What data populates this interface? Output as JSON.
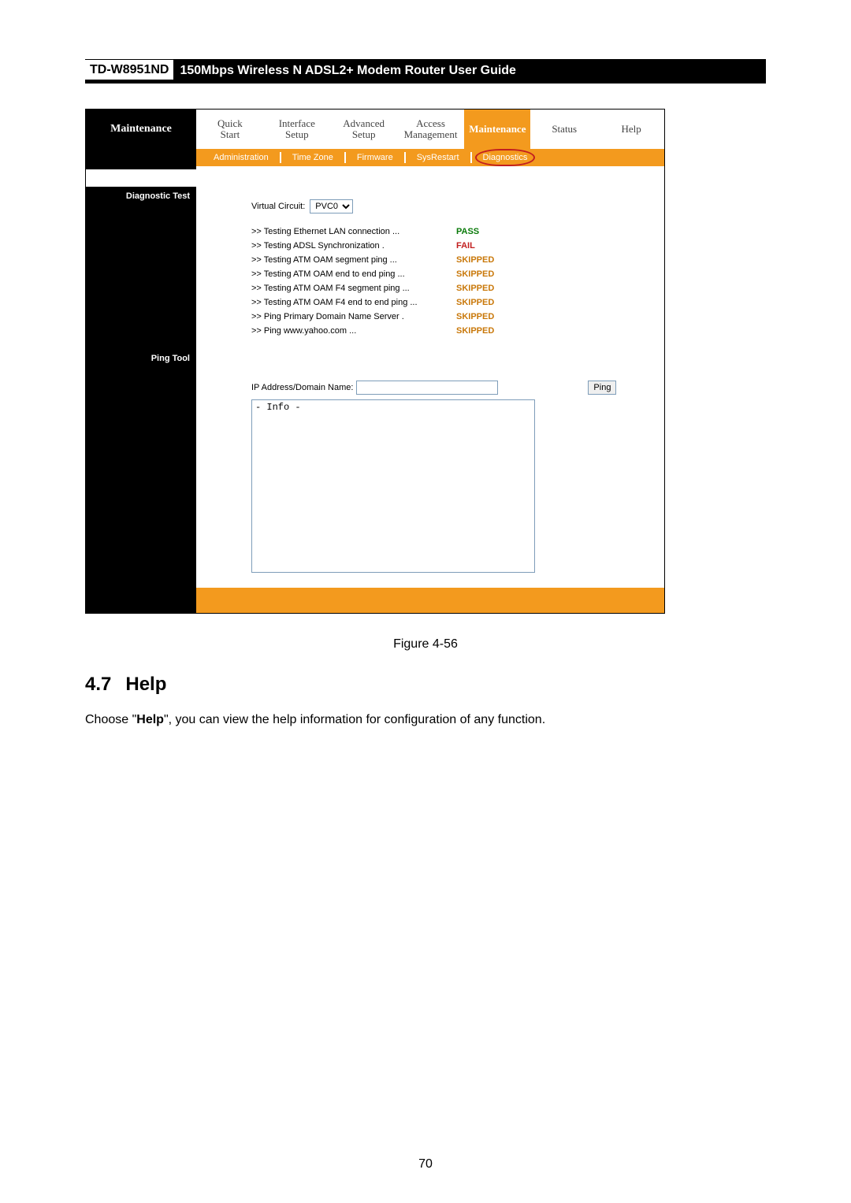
{
  "doc_header": {
    "model": "TD-W8951ND",
    "title": "150Mbps Wireless N ADSL2+ Modem Router User Guide"
  },
  "toptabs": {
    "side_label": "Maintenance",
    "items": [
      {
        "line1": "Quick",
        "line2": "Start"
      },
      {
        "line1": "Interface",
        "line2": "Setup"
      },
      {
        "line1": "Advanced",
        "line2": "Setup"
      },
      {
        "line1": "Access",
        "line2": "Management"
      },
      {
        "line1": "Maintenance",
        "line2": ""
      },
      {
        "line1": "Status",
        "line2": ""
      },
      {
        "line1": "Help",
        "line2": ""
      }
    ]
  },
  "subtabs": {
    "items": [
      "Administration",
      "Time Zone",
      "Firmware",
      "SysRestart",
      "Diagnostics"
    ]
  },
  "sections": {
    "diag_label": "Diagnostic Test",
    "ping_label": "Ping Tool"
  },
  "vc": {
    "label": "Virtual Circuit:",
    "value": "PVC0"
  },
  "diag_tests": [
    {
      "desc": ">> Testing Ethernet LAN connection ...",
      "result": "PASS",
      "cls": "pass"
    },
    {
      "desc": ">> Testing ADSL Synchronization .",
      "result": "FAIL",
      "cls": "fail"
    },
    {
      "desc": ">> Testing ATM OAM segment ping ...",
      "result": "SKIPPED",
      "cls": "skipped"
    },
    {
      "desc": ">> Testing ATM OAM end to end ping ...",
      "result": "SKIPPED",
      "cls": "skipped"
    },
    {
      "desc": ">> Testing ATM OAM F4 segment ping ...",
      "result": "SKIPPED",
      "cls": "skipped"
    },
    {
      "desc": ">> Testing ATM OAM F4 end to end ping ...",
      "result": "SKIPPED",
      "cls": "skipped"
    },
    {
      "desc": ">> Ping Primary Domain Name Server .",
      "result": "SKIPPED",
      "cls": "skipped"
    },
    {
      "desc": ">> Ping www.yahoo.com ...",
      "result": "SKIPPED",
      "cls": "skipped"
    }
  ],
  "ping": {
    "label": "IP Address/Domain Name:",
    "input_value": "",
    "btn_label": "Ping",
    "info_text": "- Info -"
  },
  "figure_caption": "Figure 4-56",
  "section": {
    "num": "4.7",
    "title": "Help"
  },
  "body_text_parts": {
    "a": "Choose \"",
    "b": "Help",
    "c": "\", you can view the help information for configuration of any function."
  },
  "page_number": "70"
}
